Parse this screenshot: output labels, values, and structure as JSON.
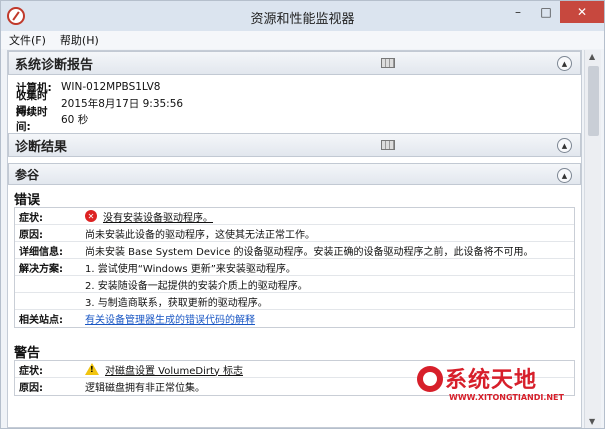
{
  "window": {
    "title": "资源和性能监视器"
  },
  "window_controls": {
    "minimize": "–",
    "maximize": "□",
    "close": "✕"
  },
  "menu": {
    "file": "文件(F)",
    "help": "帮助(H)"
  },
  "report": {
    "header": "系统诊断报告",
    "computer_label": "计算机:",
    "computer_value": "WIN-012MPBS1LV8",
    "collect_label": "收集时间:",
    "collect_value": "2015年8月17日  9:35:56",
    "duration_label": "持续时间:",
    "duration_value": "60 秒"
  },
  "diagnostics": {
    "header": "诊断结果"
  },
  "reference": {
    "header": "参谷"
  },
  "error": {
    "title": "错误",
    "symptom_label": "症状:",
    "symptom_value": "没有安装设备驱动程序。",
    "cause_label": "原因:",
    "cause_value": "尚未安装此设备的驱动程序，这使其无法正常工作。",
    "detail_label": "详细信息:",
    "detail_value": "尚未安装 Base System Device 的设备驱动程序。安装正确的设备驱动程序之前，此设备将不可用。",
    "solution_label": "解决方案:",
    "solutions": [
      "1. 尝试使用“Windows 更新”来安装驱动程序。",
      "2. 安装随设备一起提供的安装介质上的驱动程序。",
      "3. 与制造商联系，获取更新的驱动程序。"
    ],
    "related_label": "相关站点:",
    "related_link": "有关设备管理器生成的错误代码的解释"
  },
  "warning": {
    "title": "警告",
    "symptom_label": "症状:",
    "symptom_value": "对磁盘设置 VolumeDirty 标志",
    "cause_label": "原因:",
    "cause_value": "逻辑磁盘拥有非正常位集。"
  },
  "watermark": {
    "text": "系统天地",
    "sub": "WWW.XITONGTIANDI.NET"
  }
}
